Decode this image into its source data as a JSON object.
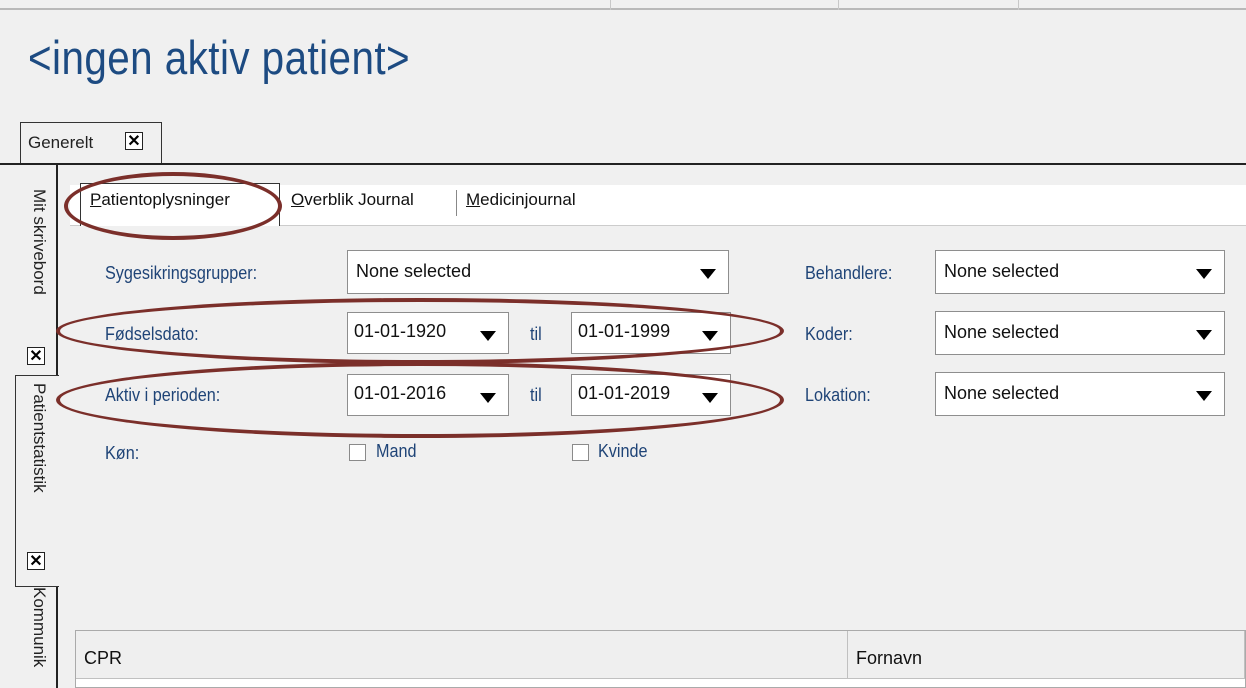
{
  "window": {
    "title": "<ingen aktiv patient>"
  },
  "top_tabs": [
    {
      "label": "Generelt",
      "close": "✕"
    }
  ],
  "side_tabs": [
    {
      "label": "Mit skrivebord",
      "close": "✕"
    },
    {
      "label": "Patientstatistik",
      "close": "✕"
    },
    {
      "label": "Kommunik"
    }
  ],
  "inner_tabs": [
    {
      "label_prefix": "P",
      "label_rest": "atientoplysninger"
    },
    {
      "label_prefix": "O",
      "label_rest": "verblik Journal"
    },
    {
      "label_prefix": "M",
      "label_rest": "edicinjournal"
    }
  ],
  "form": {
    "sygesikring_label": "Sygesikringsgrupper:",
    "sygesikring_value": "None selected",
    "foedselsdato_label": "Fødselsdato:",
    "foedselsdato_from": "01-01-1920",
    "foedselsdato_to": "01-01-1999",
    "aktiv_label": "Aktiv i perioden:",
    "aktiv_from": "01-01-2016",
    "aktiv_to": "01-01-2019",
    "til_label": "til",
    "koen_label": "Køn:",
    "mand_label": "Mand",
    "kvinde_label": "Kvinde",
    "behandlere_label": "Behandlere:",
    "behandlere_value": "None selected",
    "koder_label": "Koder:",
    "koder_value": "None selected",
    "lokation_label": "Lokation:",
    "lokation_value": "None selected"
  },
  "table": {
    "columns": [
      "CPR",
      "Fornavn"
    ]
  },
  "annotations": {
    "color": "#7b2f2a"
  }
}
